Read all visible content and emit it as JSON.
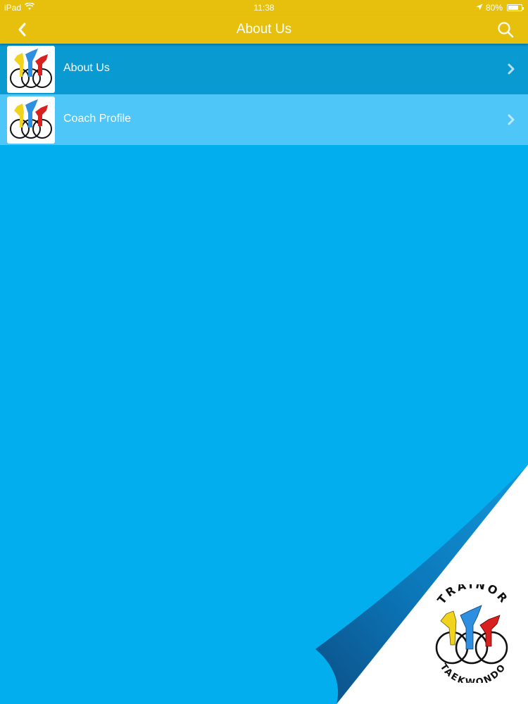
{
  "status_bar": {
    "device": "iPad",
    "time": "11:38",
    "battery_label": "80%",
    "battery_level": 0.8
  },
  "nav": {
    "title": "About Us",
    "back_icon": "chevron-left-icon",
    "search_icon": "search-icon"
  },
  "list": {
    "items": [
      {
        "label": "About Us",
        "icon": "taekwondo-logo"
      },
      {
        "label": "Coach Profile",
        "icon": "taekwondo-logo"
      }
    ]
  },
  "brand": {
    "logo_top_text": "TRAINOR",
    "logo_bottom_text": "TAEKWONDO"
  },
  "colors": {
    "header": "#e7c00d",
    "background": "#03aeee",
    "row_1": "#0a9ad2",
    "row_2": "#4ec6f8",
    "yellow": "#f2d31b",
    "blue": "#2e8fe0",
    "red": "#d92020"
  }
}
